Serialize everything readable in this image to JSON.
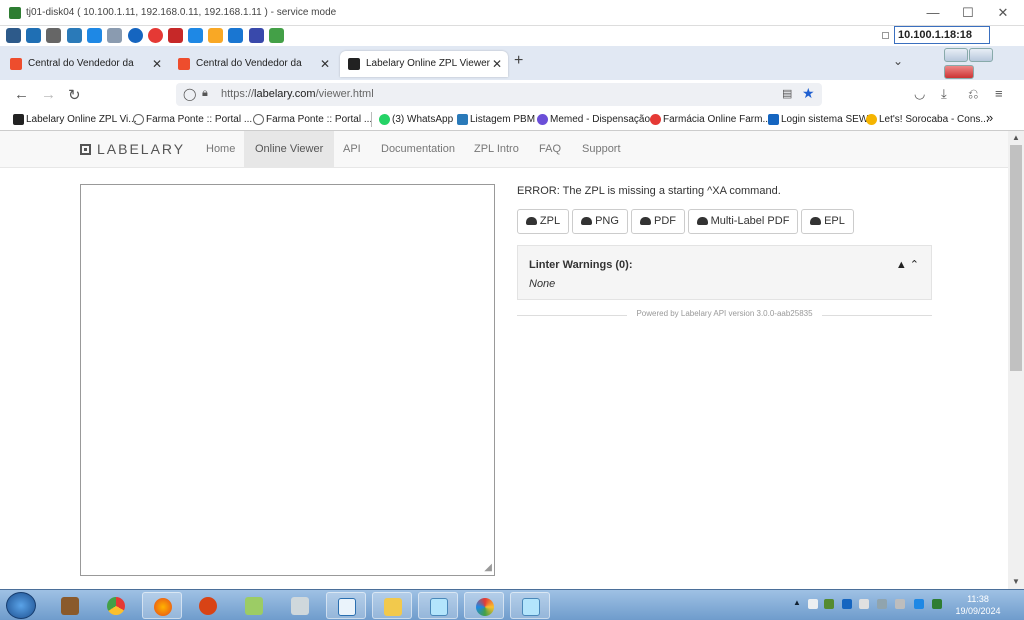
{
  "remote_window": {
    "title": "tj01-disk04 ( 10.100.1.11, 192.168.0.11, 192.168.1.11 ) - service mode",
    "ip_box": "10.100.1.18:18",
    "controls": {
      "minimize": "—",
      "maximize": "☐",
      "close": "✕"
    }
  },
  "browser": {
    "tabs": [
      {
        "label": "Central do Vendedor da Shopee",
        "favicon_color": "#ee4d2d",
        "active": false
      },
      {
        "label": "Central do Vendedor da Shopee",
        "favicon_color": "#ee4d2d",
        "active": false
      },
      {
        "label": "Labelary Online ZPL Viewer",
        "favicon_color": "#222222",
        "active": true
      }
    ],
    "new_tab": "+",
    "tab_list": "⌄",
    "url": {
      "scheme": "https://",
      "domain": "labelary.com",
      "path": "/viewer.html"
    },
    "bookmarks": [
      {
        "label": "Labelary Online ZPL Vi...",
        "color": "#222222"
      },
      {
        "label": "Farma Ponte :: Portal ...",
        "color": "#666666"
      },
      {
        "label": "Farma Ponte :: Portal ...",
        "color": "#666666"
      },
      {
        "label": "(3) WhatsApp",
        "color": "#25d366"
      },
      {
        "label": "Listagem PBM",
        "color": "#2a7ab9"
      },
      {
        "label": "Memed - Dispensação",
        "color": "#6b4fd8"
      },
      {
        "label": "Farmácia Online Farm...",
        "color": "#e53935"
      },
      {
        "label": "Login sistema SEW",
        "color": "#1565c0"
      },
      {
        "label": "Let's! Sorocaba - Cons...",
        "color": "#f5b400"
      }
    ],
    "bookmarks_overflow": "»"
  },
  "site": {
    "logo": "LABELARY",
    "nav": [
      "Home",
      "Online Viewer",
      "API",
      "Documentation",
      "ZPL Intro",
      "FAQ",
      "Support"
    ],
    "active_nav": "Online Viewer",
    "error": "ERROR: The ZPL is missing a starting ^XA command.",
    "buttons": [
      "ZPL",
      "PNG",
      "PDF",
      "Multi-Label PDF",
      "EPL"
    ],
    "linter": {
      "title": "Linter Warnings (0):",
      "value": "None",
      "icons": "▲ ⌃"
    },
    "powered": "Powered by Labelary API version 3.0.0-aab25835"
  },
  "taskbar": {
    "clock_time": "11:38",
    "clock_date": "19/09/2024",
    "apps": [
      "briefcase",
      "chrome",
      "firefox",
      "user",
      "seven",
      "printer",
      "vidalink",
      "folder",
      "window",
      "paint",
      "window2"
    ]
  }
}
